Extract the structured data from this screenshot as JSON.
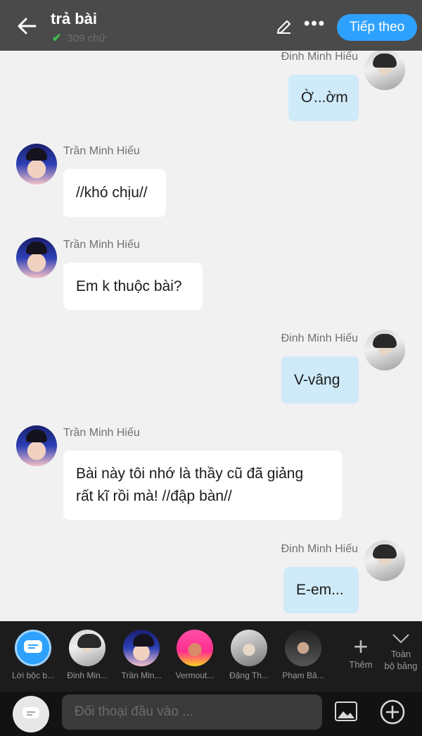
{
  "header": {
    "title": "trả bài",
    "word_count": "309 chữ",
    "next_label": "Tiếp theo"
  },
  "messages": [
    {
      "name": "Đinh Minh Hiếu",
      "text": "Ờ...ờm"
    },
    {
      "name": "Trần Minh Hiếu",
      "text": "//khó chịu//"
    },
    {
      "name": "Trần Minh Hiếu",
      "text": "Em k thuộc bài?"
    },
    {
      "name": "Đinh Minh Hiếu",
      "text": "V-vâng"
    },
    {
      "name": "Trần Minh Hiếu",
      "text_line1": "Bài này tôi nhớ là thầy cũ đã giảng",
      "text_line2": "rất kĩ rồi mà! //đập bàn//"
    },
    {
      "name": "Đinh Minh Hiếu",
      "text": "E-em..."
    }
  ],
  "characters": [
    {
      "label": "Lời bộc b..."
    },
    {
      "label": "Đinh Min..."
    },
    {
      "label": "Trần Min..."
    },
    {
      "label": "Vermout..."
    },
    {
      "label": "Đặng Th..."
    },
    {
      "label": "Phạm Bả..."
    }
  ],
  "toolbar": {
    "add_label": "Thêm",
    "full_board_line1": "Toàn",
    "full_board_line2": "bộ bảng"
  },
  "input": {
    "placeholder": "Đối thoại đầu vào ..."
  },
  "colors": {
    "accent": "#2ea1ff",
    "outgoing_bubble": "#cfeaf8",
    "incoming_bubble": "#ffffff",
    "header_bg": "#4a4a4a"
  }
}
